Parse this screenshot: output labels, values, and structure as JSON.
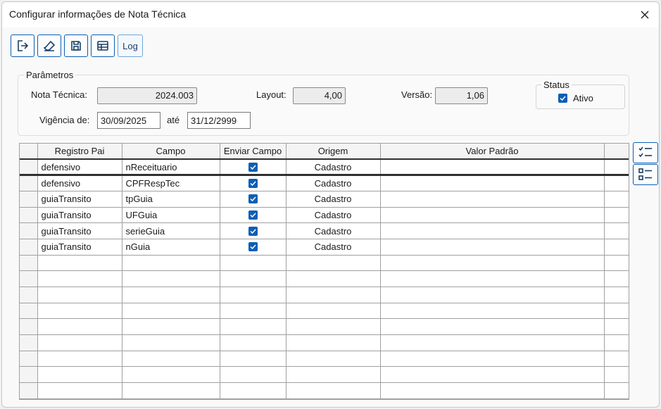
{
  "window": {
    "title": "Configurar informações de Nota Técnica"
  },
  "toolbar": {
    "buttons": [
      {
        "icon": "exit-icon"
      },
      {
        "icon": "eraser-icon"
      },
      {
        "icon": "save-icon"
      },
      {
        "icon": "table-icon"
      }
    ],
    "log_label": "Log"
  },
  "params": {
    "legend": "Parâmetros",
    "nota_tecnica_label": "Nota Técnica:",
    "nota_tecnica_value": "2024.003",
    "layout_label": "Layout:",
    "layout_value": "4,00",
    "versao_label": "Versão:",
    "versao_value": "1,06",
    "vigencia_label": "Vigência de:",
    "vigencia_de": "30/09/2025",
    "ate_label": "até",
    "vigencia_ate": "31/12/2999",
    "status": {
      "legend": "Status",
      "ativo_label": "Ativo",
      "ativo_checked": true
    }
  },
  "grid": {
    "columns": [
      "Registro Pai",
      "Campo",
      "Enviar Campo",
      "Origem",
      "Valor Padrão"
    ],
    "rows": [
      {
        "registro_pai": "defensivo",
        "campo": "nReceituario",
        "enviar": true,
        "origem": "Cadastro",
        "valor": ""
      },
      {
        "registro_pai": "defensivo",
        "campo": "CPFRespTec",
        "enviar": true,
        "origem": "Cadastro",
        "valor": ""
      },
      {
        "registro_pai": "guiaTransito",
        "campo": "tpGuia",
        "enviar": true,
        "origem": "Cadastro",
        "valor": ""
      },
      {
        "registro_pai": "guiaTransito",
        "campo": "UFGuia",
        "enviar": true,
        "origem": "Cadastro",
        "valor": ""
      },
      {
        "registro_pai": "guiaTransito",
        "campo": "serieGuia",
        "enviar": true,
        "origem": "Cadastro",
        "valor": ""
      },
      {
        "registro_pai": "guiaTransito",
        "campo": "nGuia",
        "enviar": true,
        "origem": "Cadastro",
        "valor": ""
      }
    ],
    "empty_rows": 9
  },
  "side_buttons": [
    {
      "icon": "checklist-icon"
    },
    {
      "icon": "unchecklist-icon"
    }
  ],
  "colors": {
    "accent": "#0a5fb4"
  }
}
